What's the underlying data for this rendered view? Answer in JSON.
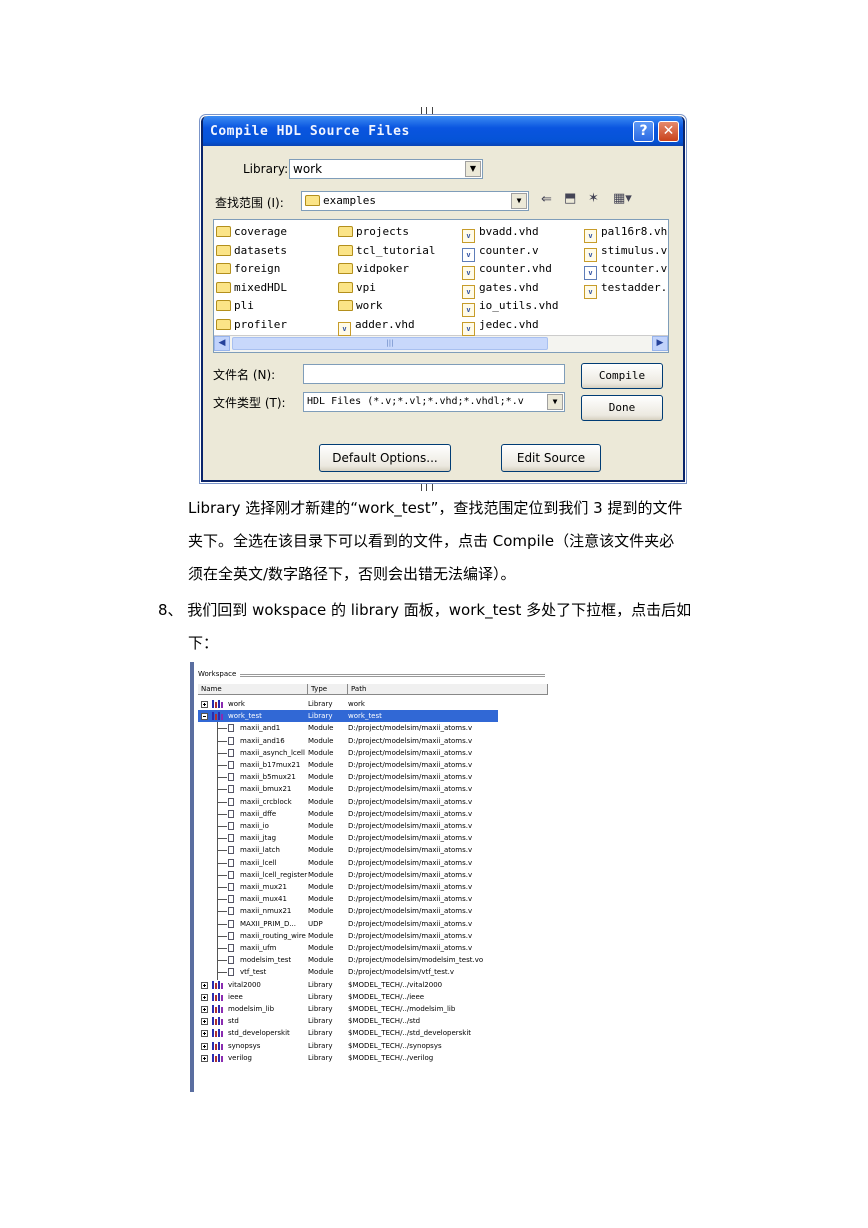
{
  "dialog": {
    "title": "Compile HDL Source Files",
    "library_label": "Library:",
    "library_value": "work",
    "lookin_label": "查找范围 (I):",
    "lookin_value": "examples",
    "filename_label": "文件名 (N):",
    "filename_value": "",
    "filetype_label": "文件类型 (T):",
    "filetype_value": "HDL Files (*.v;*.vl;*.vhd;*.vhdl;*.v",
    "compile_label": "Compile",
    "done_label": "Done",
    "default_options_label": "Default Options...",
    "edit_source_label": "Edit Source",
    "files": [
      {
        "name": "coverage",
        "type": "folder"
      },
      {
        "name": "datasets",
        "type": "folder"
      },
      {
        "name": "foreign",
        "type": "folder"
      },
      {
        "name": "mixedHDL",
        "type": "folder"
      },
      {
        "name": "pli",
        "type": "folder"
      },
      {
        "name": "profiler",
        "type": "folder"
      },
      {
        "name": "projects",
        "type": "folder"
      },
      {
        "name": "tcl_tutorial",
        "type": "folder"
      },
      {
        "name": "vidpoker",
        "type": "folder"
      },
      {
        "name": "vpi",
        "type": "folder"
      },
      {
        "name": "work",
        "type": "folder"
      },
      {
        "name": "adder.vhd",
        "type": "vhd"
      },
      {
        "name": "bvadd.vhd",
        "type": "vhd"
      },
      {
        "name": "counter.v",
        "type": "v"
      },
      {
        "name": "counter.vhd",
        "type": "vhd"
      },
      {
        "name": "gates.vhd",
        "type": "vhd"
      },
      {
        "name": "io_utils.vhd",
        "type": "vhd"
      },
      {
        "name": "jedec.vhd",
        "type": "vhd"
      },
      {
        "name": "pal16r8.vh",
        "type": "vhd"
      },
      {
        "name": "stimulus.v:",
        "type": "vhd"
      },
      {
        "name": "tcounter.v",
        "type": "v"
      },
      {
        "name": "testadder.",
        "type": "vhd"
      }
    ]
  },
  "text": {
    "line1": "Library 选择刚才新建的“work_test”，查找范围定位到我们 3 提到的文件",
    "line2": "夹下。全选在该目录下可以看到的文件，点击 Compile（注意该文件夹必",
    "line3": "须在全英文/数字路径下，否则会出错无法编译）。",
    "line4": "8、 我们回到 wokspace 的 library 面板，work_test 多处了下拉框，点击后如",
    "line5": "下："
  },
  "workspace": {
    "caption": "Workspace",
    "headers": [
      "Name",
      "Type",
      "Path"
    ],
    "rows": [
      {
        "name": "work",
        "type": "Library",
        "path": "work",
        "kind": "lib",
        "expand": "plus"
      },
      {
        "name": "work_test",
        "type": "Library",
        "path": "work_test",
        "kind": "lib",
        "expand": "minus",
        "selected": true
      },
      {
        "name": "maxii_and1",
        "type": "Module",
        "path": "D:/project/modelsim/maxii_atoms.v",
        "kind": "mod"
      },
      {
        "name": "maxii_and16",
        "type": "Module",
        "path": "D:/project/modelsim/maxii_atoms.v",
        "kind": "mod"
      },
      {
        "name": "maxii_asynch_lcell",
        "type": "Module",
        "path": "D:/project/modelsim/maxii_atoms.v",
        "kind": "mod"
      },
      {
        "name": "maxii_b17mux21",
        "type": "Module",
        "path": "D:/project/modelsim/maxii_atoms.v",
        "kind": "mod"
      },
      {
        "name": "maxii_b5mux21",
        "type": "Module",
        "path": "D:/project/modelsim/maxii_atoms.v",
        "kind": "mod"
      },
      {
        "name": "maxii_bmux21",
        "type": "Module",
        "path": "D:/project/modelsim/maxii_atoms.v",
        "kind": "mod"
      },
      {
        "name": "maxii_crcblock",
        "type": "Module",
        "path": "D:/project/modelsim/maxii_atoms.v",
        "kind": "mod"
      },
      {
        "name": "maxii_dffe",
        "type": "Module",
        "path": "D:/project/modelsim/maxii_atoms.v",
        "kind": "mod"
      },
      {
        "name": "maxii_io",
        "type": "Module",
        "path": "D:/project/modelsim/maxii_atoms.v",
        "kind": "mod"
      },
      {
        "name": "maxii_jtag",
        "type": "Module",
        "path": "D:/project/modelsim/maxii_atoms.v",
        "kind": "mod"
      },
      {
        "name": "maxii_latch",
        "type": "Module",
        "path": "D:/project/modelsim/maxii_atoms.v",
        "kind": "mod"
      },
      {
        "name": "maxii_lcell",
        "type": "Module",
        "path": "D:/project/modelsim/maxii_atoms.v",
        "kind": "mod"
      },
      {
        "name": "maxii_lcell_register",
        "type": "Module",
        "path": "D:/project/modelsim/maxii_atoms.v",
        "kind": "mod"
      },
      {
        "name": "maxii_mux21",
        "type": "Module",
        "path": "D:/project/modelsim/maxii_atoms.v",
        "kind": "mod"
      },
      {
        "name": "maxii_mux41",
        "type": "Module",
        "path": "D:/project/modelsim/maxii_atoms.v",
        "kind": "mod"
      },
      {
        "name": "maxii_nmux21",
        "type": "Module",
        "path": "D:/project/modelsim/maxii_atoms.v",
        "kind": "mod"
      },
      {
        "name": "MAXII_PRIM_D...",
        "type": "UDP",
        "path": "D:/project/modelsim/maxii_atoms.v",
        "kind": "mod"
      },
      {
        "name": "maxii_routing_wire",
        "type": "Module",
        "path": "D:/project/modelsim/maxii_atoms.v",
        "kind": "mod"
      },
      {
        "name": "maxii_ufm",
        "type": "Module",
        "path": "D:/project/modelsim/maxii_atoms.v",
        "kind": "mod"
      },
      {
        "name": "modelsim_test",
        "type": "Module",
        "path": "D:/project/modelsim/modelsim_test.vo",
        "kind": "mod"
      },
      {
        "name": "vtf_test",
        "type": "Module",
        "path": "D:/project/modelsim/vtf_test.v",
        "kind": "mod"
      },
      {
        "name": "vital2000",
        "type": "Library",
        "path": "$MODEL_TECH/../vital2000",
        "kind": "lib",
        "expand": "plus"
      },
      {
        "name": "ieee",
        "type": "Library",
        "path": "$MODEL_TECH/../ieee",
        "kind": "lib",
        "expand": "plus"
      },
      {
        "name": "modelsim_lib",
        "type": "Library",
        "path": "$MODEL_TECH/../modelsim_lib",
        "kind": "lib",
        "expand": "plus"
      },
      {
        "name": "std",
        "type": "Library",
        "path": "$MODEL_TECH/../std",
        "kind": "lib",
        "expand": "plus"
      },
      {
        "name": "std_developerskit",
        "type": "Library",
        "path": "$MODEL_TECH/../std_developerskit",
        "kind": "lib",
        "expand": "plus"
      },
      {
        "name": "synopsys",
        "type": "Library",
        "path": "$MODEL_TECH/../synopsys",
        "kind": "lib",
        "expand": "plus"
      },
      {
        "name": "verilog",
        "type": "Library",
        "path": "$MODEL_TECH/../verilog",
        "kind": "lib",
        "expand": "plus"
      }
    ]
  }
}
